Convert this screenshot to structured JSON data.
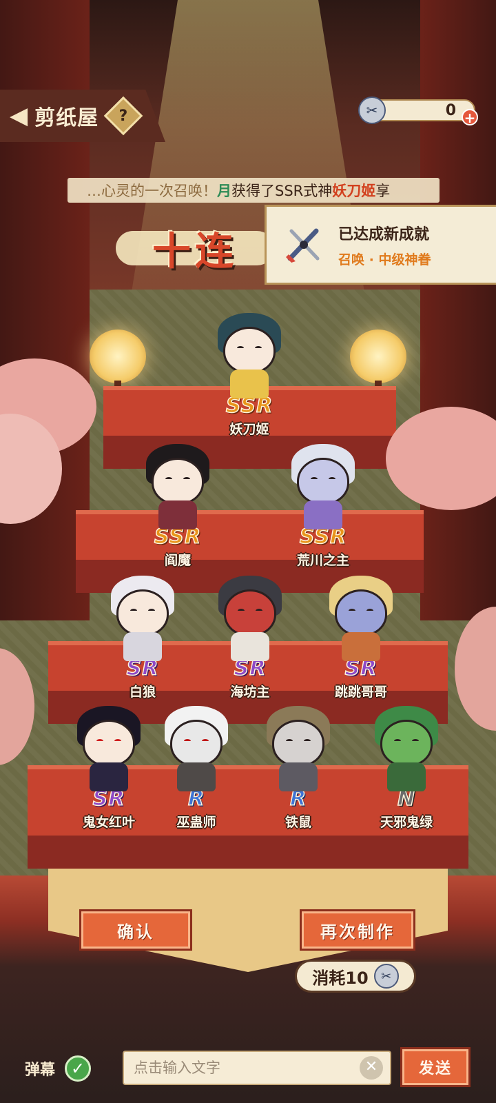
{
  "header": {
    "title": "剪纸屋",
    "help_label": "?",
    "back_icon": "back-arrow-icon"
  },
  "currency": {
    "amount": "0",
    "plus_label": "+",
    "icon": "paper-doll-ticket-icon"
  },
  "marquee": {
    "lead": "…心灵的一次召唤！",
    "player": "月",
    "middle": "获得了SSR式神",
    "shikigami": "妖刀姬",
    "tail": "享"
  },
  "summon_title": "十连",
  "achievement": {
    "title": "已达成新成就",
    "subtitle": "召唤 · 中级神眷",
    "icon": "crossed-swords-icon"
  },
  "results": [
    {
      "rarity": "SSR",
      "name": "妖刀姬"
    },
    {
      "rarity": "SSR",
      "name": "阎魔"
    },
    {
      "rarity": "SSR",
      "name": "荒川之主"
    },
    {
      "rarity": "SR",
      "name": "白狼"
    },
    {
      "rarity": "SR",
      "name": "海坊主"
    },
    {
      "rarity": "SR",
      "name": "跳跳哥哥"
    },
    {
      "rarity": "SR",
      "name": "鬼女红叶"
    },
    {
      "rarity": "R",
      "name": "巫蛊师"
    },
    {
      "rarity": "R",
      "name": "铁鼠"
    },
    {
      "rarity": "N",
      "name": "天邪鬼绿"
    }
  ],
  "buttons": {
    "confirm": "确认",
    "again": "再次制作"
  },
  "cost": {
    "label": "消耗10",
    "icon": "paper-doll-ticket-icon"
  },
  "chat": {
    "danmu_label": "弹幕",
    "danmu_enabled": true,
    "placeholder": "点击输入文字",
    "send": "发送"
  },
  "colors": {
    "ssr": "#e8941a",
    "sr": "#8d49c7",
    "r": "#3d73d6",
    "n": "#6c6c6c",
    "button": "#e5673a"
  }
}
